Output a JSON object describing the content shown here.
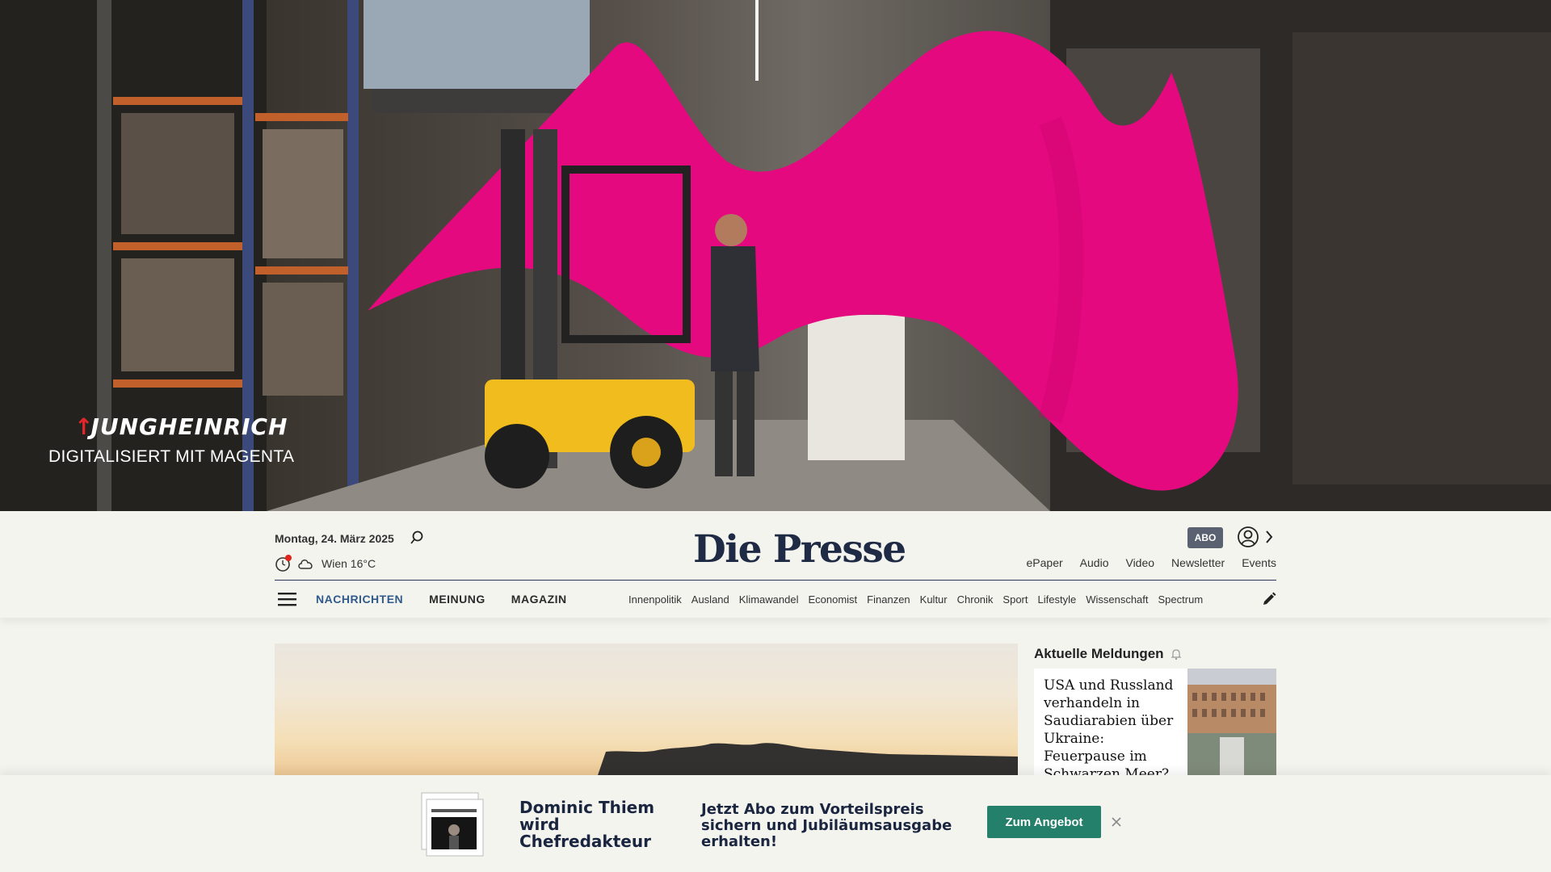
{
  "ad": {
    "brand": "JUNGHEINRICH",
    "tagline": "DIGITALISIERT MIT MAGENTA",
    "accent_color": "#e5097f"
  },
  "header": {
    "date": "Montag, 24. März 2025",
    "weather": "Wien 16°C",
    "logo": "Die Presse",
    "abo_label": "ABO",
    "quicklinks": [
      "ePaper",
      "Audio",
      "Video",
      "Newsletter",
      "Events"
    ],
    "main_nav": [
      "NACHRICHTEN",
      "MEINUNG",
      "MAGAZIN"
    ],
    "sub_nav": [
      "Innenpolitik",
      "Ausland",
      "Klimawandel",
      "Economist",
      "Finanzen",
      "Kultur",
      "Chronik",
      "Sport",
      "Lifestyle",
      "Wissenschaft",
      "Spectrum"
    ],
    "brand_color": "#1f2a44",
    "active_color": "#2f5a8a"
  },
  "sidebar": {
    "title": "Aktuelle Meldungen",
    "news": [
      {
        "headline": "USA und Russland verhandeln in Saudiarabien über Ukraine: Feuerpause im Schwarzen Meer?"
      }
    ]
  },
  "promo": {
    "title": "Dominic Thiem wird Chefredakteur",
    "text": "Jetzt Abo zum Vorteilspreis sichern und Jubiläumsausgabe erhalten!",
    "button": "Zum Angebot",
    "button_color": "#24806a"
  }
}
